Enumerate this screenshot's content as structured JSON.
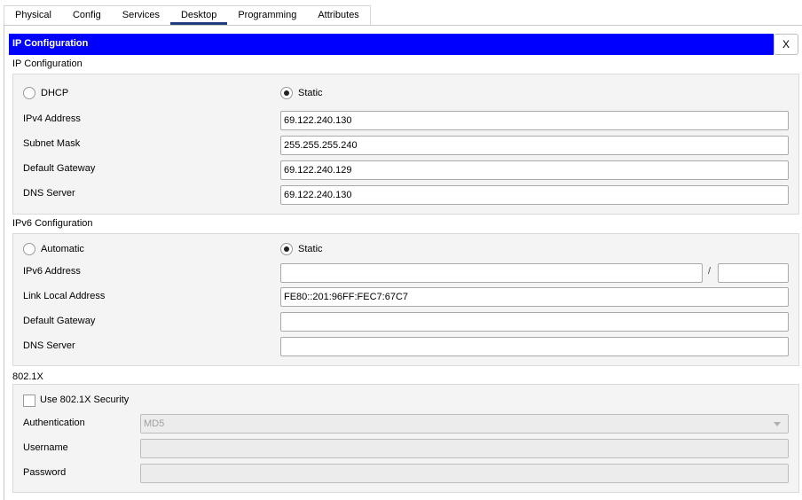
{
  "tabs": [
    {
      "label": "Physical"
    },
    {
      "label": "Config"
    },
    {
      "label": "Services"
    },
    {
      "label": "Desktop"
    },
    {
      "label": "Programming"
    },
    {
      "label": "Attributes"
    }
  ],
  "window": {
    "title": "IP Configuration",
    "close_label": "X"
  },
  "ipv4": {
    "section_label": "IP Configuration",
    "dhcp_label": "DHCP",
    "static_label": "Static",
    "selected_mode": "Static",
    "address_label": "IPv4 Address",
    "address_value": "69.122.240.130",
    "subnet_label": "Subnet Mask",
    "subnet_value": "255.255.255.240",
    "gateway_label": "Default Gateway",
    "gateway_value": "69.122.240.129",
    "dns_label": "DNS Server",
    "dns_value": "69.122.240.130"
  },
  "ipv6": {
    "section_label": "IPv6 Configuration",
    "auto_label": "Automatic",
    "static_label": "Static",
    "selected_mode": "Static",
    "address_label": "IPv6 Address",
    "address_value": "",
    "prefix_separator": "/",
    "prefix_value": "",
    "link_local_label": "Link Local Address",
    "link_local_value": "FE80::201:96FF:FEC7:67C7",
    "gateway_label": "Default Gateway",
    "gateway_value": "",
    "dns_label": "DNS Server",
    "dns_value": ""
  },
  "dot1x": {
    "section_label": "802.1X",
    "use_security_label": "Use 802.1X Security",
    "use_security_checked": false,
    "auth_label": "Authentication",
    "auth_value": "MD5",
    "username_label": "Username",
    "username_value": "",
    "password_label": "Password",
    "password_value": ""
  }
}
